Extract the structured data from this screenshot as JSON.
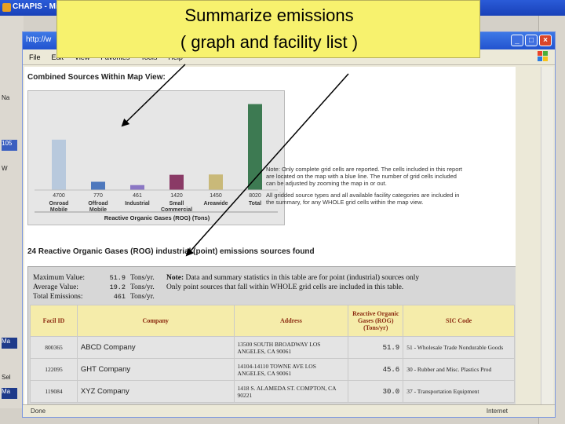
{
  "callout": {
    "line1": "Summarize emissions",
    "line2": "( graph and facility list )"
  },
  "outer_window": {
    "title": "CHAPIS - Mic",
    "left_strip": [
      "Na",
      "105",
      "W",
      "Ma",
      "Sel",
      "Ma"
    ]
  },
  "browser": {
    "address": "http://w",
    "menu": [
      "File",
      "Edit",
      "View",
      "Favorites",
      "Tools",
      "Help"
    ],
    "status_left": "Done",
    "status_right": "Internet"
  },
  "chart_section": {
    "heading": "Combined Sources Within Map View:"
  },
  "chart_data": {
    "type": "bar",
    "categories": [
      "Onroad Mobile",
      "Offroad Mobile",
      "Industrial",
      "Small Commercial",
      "Areawide",
      "Total"
    ],
    "values": [
      4700,
      770,
      461,
      1420,
      1450,
      8020
    ],
    "value_labels": [
      "4700",
      "770",
      "461",
      "1420",
      "1450",
      "8020"
    ],
    "colors": [
      "#b8c9dd",
      "#4e78bd",
      "#8b77c4",
      "#8a3a66",
      "#c9b979",
      "#3d7a52"
    ],
    "xlabel": "Reactive Organic Gases (ROG) (Tons)",
    "ylim": [
      0,
      8500
    ]
  },
  "notes": {
    "p1": "Note: Only complete grid cells are reported. The cells included in this report are located on the map with a blue line. The number of grid cells included can be adjusted by zooming the map in or out.",
    "p2": "All gridded source types and all available facility categories are included in the summary, for any WHOLE grid cells within the map view."
  },
  "table_section": {
    "heading": "24 Reactive Organic Gases (ROG) industrial (point) emissions sources found",
    "stats": {
      "max_label": "Maximum Value:",
      "max_value": "51.9",
      "avg_label": "Average Value:",
      "avg_value": "19.2",
      "total_label": "Total Emissions:",
      "total_value": "461",
      "unit": "Tons/yr."
    },
    "note_bold": "Note:",
    "note_line1": "Data and summary statistics in this table are for point (industrial) sources only",
    "note_line2": "Only point sources that fall within WHOLE grid cells are included in this table.",
    "columns": [
      "Facil ID",
      "Company",
      "Address",
      "Reactive Organic Gases (ROG) (Tons/yr)",
      "SIC Code"
    ],
    "rows": [
      {
        "id": "800365",
        "company": "ABCD Company",
        "address": "13500 SOUTH BROADWAY LOS ANGELES, CA 90061",
        "rog": "51.9",
        "sic": "51 - Wholesale Trade Nondurable Goods"
      },
      {
        "id": "122095",
        "company": "GHT Company",
        "address": "14104-14110 TOWNE AVE LOS ANGELES, CA 90061",
        "rog": "45.6",
        "sic": "30 - Rubber and Misc. Plastics Prod"
      },
      {
        "id": "119084",
        "company": "XYZ Company",
        "address": "1418 S. ALAMEDA ST. COMPTON, CA 90221",
        "rog": "30.0",
        "sic": "37 - Transportation Equipment"
      }
    ]
  }
}
